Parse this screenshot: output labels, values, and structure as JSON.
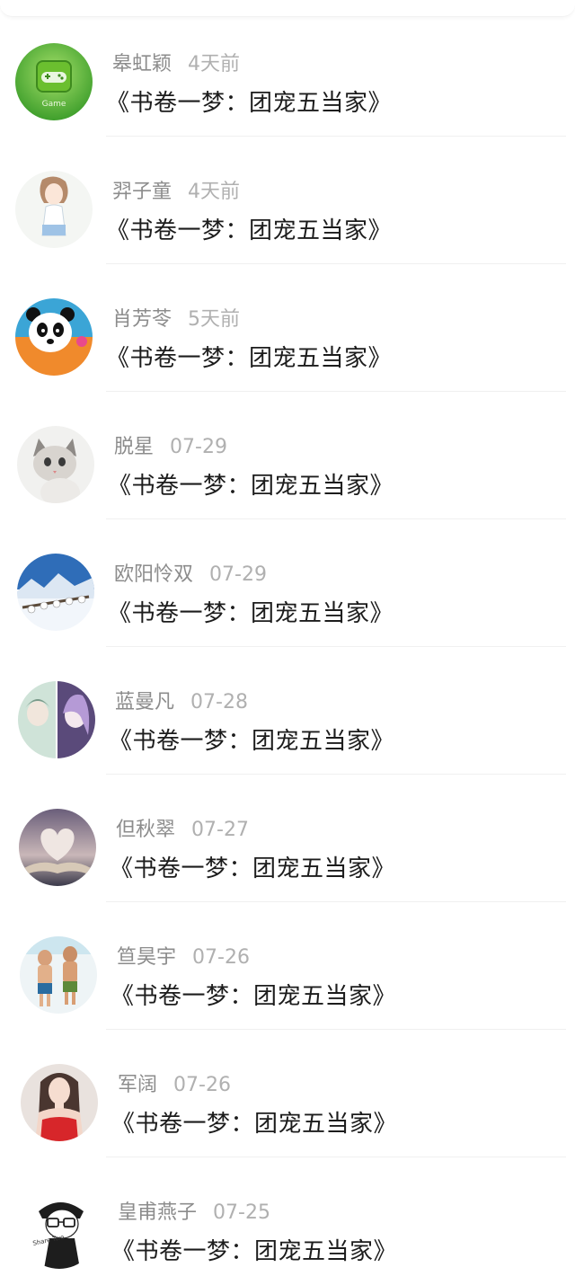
{
  "items": [
    {
      "name": "皋虹颖",
      "time": "4天前",
      "title": "《书卷一梦：团宠五当家》",
      "avatar_icon": "game-controller-avatar"
    },
    {
      "name": "羿子童",
      "time": "4天前",
      "title": "《书卷一梦：团宠五当家》",
      "avatar_icon": "anime-girl-avatar"
    },
    {
      "name": "肖芳苓",
      "time": "5天前",
      "title": "《书卷一梦：团宠五当家》",
      "avatar_icon": "panda-avatar"
    },
    {
      "name": "脱星",
      "time": "07-29",
      "title": "《书卷一梦：团宠五当家》",
      "avatar_icon": "kitten-avatar"
    },
    {
      "name": "欧阳怜双",
      "time": "07-29",
      "title": "《书卷一梦：团宠五当家》",
      "avatar_icon": "snow-landscape-avatar"
    },
    {
      "name": "蓝曼凡",
      "time": "07-28",
      "title": "《书卷一梦：团宠五当家》",
      "avatar_icon": "anime-pair-avatar"
    },
    {
      "name": "但秋翠",
      "time": "07-27",
      "title": "《书卷一梦：团宠五当家》",
      "avatar_icon": "book-heart-avatar"
    },
    {
      "name": "笪昊宇",
      "time": "07-26",
      "title": "《书卷一梦：团宠五当家》",
      "avatar_icon": "beach-friends-avatar"
    },
    {
      "name": "军阔",
      "time": "07-26",
      "title": "《书卷一梦：团宠五当家》",
      "avatar_icon": "woman-red-dress-avatar"
    },
    {
      "name": "皇甫燕子",
      "time": "07-25",
      "title": "《书卷一梦：团宠五当家》",
      "avatar_icon": "cartoon-boy-glasses-avatar"
    }
  ],
  "overlay_text": {
    "game_label": "Game",
    "share_label": "Share Two"
  }
}
